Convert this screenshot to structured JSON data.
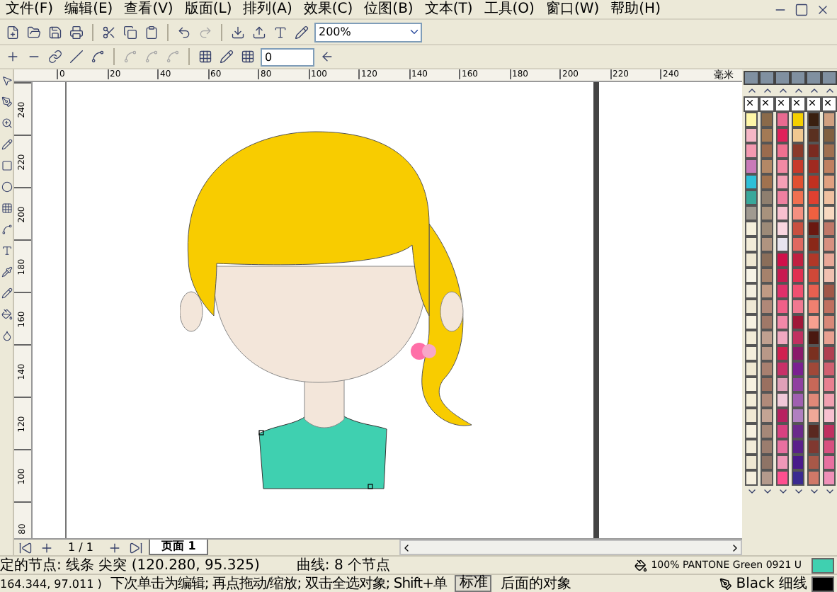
{
  "menu": [
    "文件(F)",
    "编辑(E)",
    "查看(V)",
    "版面(L)",
    "排列(A)",
    "效果(C)",
    "位图(B)",
    "文本(T)",
    "工具(O)",
    "窗口(W)",
    "帮助(H)"
  ],
  "toolbar": {
    "zoom": "200%"
  },
  "property_bar": {
    "value": "0"
  },
  "ruler": {
    "h_labels": [
      "0",
      "20",
      "40",
      "60",
      "80",
      "100",
      "120",
      "140",
      "160",
      "180",
      "200",
      "220",
      "240"
    ],
    "unit": "毫米",
    "v_labels": [
      "240",
      "220",
      "200",
      "180",
      "160",
      "140",
      "120",
      "100",
      "80"
    ]
  },
  "page_nav": {
    "count": "1 / 1",
    "tabs": [
      {
        "label": "页面 1",
        "selected": true
      }
    ]
  },
  "palettes": [
    {
      "swatches": [
        {
          "color": "#fff7a8"
        },
        {
          "color": "#f5b7c5"
        },
        {
          "color": "#f49ab0"
        },
        {
          "color": "#c97ab8"
        },
        {
          "color": "#2fc0d8"
        },
        {
          "color": "#3aa89a"
        },
        {
          "color": "#a09a90"
        },
        {
          "color": "#f5f0dc"
        },
        {
          "color": "#f2ecd8"
        },
        {
          "color": "#efe8d2"
        },
        {
          "color": "#f6f3e6"
        },
        {
          "color": "#f3eedf"
        },
        {
          "color": "#efe9d5"
        },
        {
          "color": "#f7f2e2"
        },
        {
          "color": "#f2ecd8"
        },
        {
          "color": "#f5efdc"
        },
        {
          "color": "#efe8d2"
        },
        {
          "color": "#f6f1e0"
        },
        {
          "color": "#f3edd8"
        },
        {
          "color": "#f0e9d4"
        },
        {
          "color": "#f6f0df"
        },
        {
          "color": "#f2ecd9"
        },
        {
          "color": "#efe8d3"
        },
        {
          "color": "#f5efdd"
        }
      ]
    },
    {
      "swatches": [
        {
          "color": "#8a6a4a"
        },
        {
          "color": "#a37a55"
        },
        {
          "color": "#9b6b4e"
        },
        {
          "color": "#b38866"
        },
        {
          "color": "#a0724f"
        },
        {
          "color": "#8f7f6f"
        },
        {
          "color": "#a8927d"
        },
        {
          "color": "#9c8a78"
        },
        {
          "color": "#b09480"
        },
        {
          "color": "#8a6e5a"
        },
        {
          "color": "#a6826c"
        },
        {
          "color": "#c09a84"
        },
        {
          "color": "#b08878"
        },
        {
          "color": "#a07868"
        },
        {
          "color": "#c0a090"
        },
        {
          "color": "#b89888"
        },
        {
          "color": "#a88070"
        },
        {
          "color": "#9a7060"
        },
        {
          "color": "#b08a7a"
        },
        {
          "color": "#c4a494"
        },
        {
          "color": "#a68878"
        },
        {
          "color": "#9b7d6e"
        },
        {
          "color": "#8e7466"
        },
        {
          "color": "#b49a8c"
        }
      ]
    },
    {
      "swatches": [
        {
          "color": "#e86a90"
        },
        {
          "color": "#e0205a"
        },
        {
          "color": "#f07090"
        },
        {
          "color": "#f38aa4"
        },
        {
          "color": "#f5a0b6"
        },
        {
          "color": "#ef80a0"
        },
        {
          "color": "#f7c0cf"
        },
        {
          "color": "#f9d6df"
        },
        {
          "color": "#e8e4ee"
        },
        {
          "color": "#d0104a"
        },
        {
          "color": "#c81a50"
        },
        {
          "color": "#e0306a"
        },
        {
          "color": "#f06088"
        },
        {
          "color": "#f288a8"
        },
        {
          "color": "#f0a8c0"
        },
        {
          "color": "#d02050"
        },
        {
          "color": "#c83068"
        },
        {
          "color": "#e0a0b8"
        },
        {
          "color": "#f0c8d8"
        },
        {
          "color": "#b82060"
        },
        {
          "color": "#d84080"
        },
        {
          "color": "#e870a0"
        },
        {
          "color": "#f098b8"
        },
        {
          "color": "#ff4f8f"
        }
      ]
    },
    {
      "swatches": [
        {
          "color": "#f5d000"
        },
        {
          "color": "#f0c890"
        },
        {
          "color": "#8a3a2a"
        },
        {
          "color": "#c83a2a"
        },
        {
          "color": "#e05030"
        },
        {
          "color": "#f07050"
        },
        {
          "color": "#f59080"
        },
        {
          "color": "#c85040"
        },
        {
          "color": "#e06860"
        },
        {
          "color": "#c02040"
        },
        {
          "color": "#e03050"
        },
        {
          "color": "#f05070"
        },
        {
          "color": "#f07890"
        },
        {
          "color": "#a01838"
        },
        {
          "color": "#c03060"
        },
        {
          "color": "#8a1a6a"
        },
        {
          "color": "#7a2090"
        },
        {
          "color": "#9040a0"
        },
        {
          "color": "#a060b0"
        },
        {
          "color": "#b080c0"
        },
        {
          "color": "#6a2a8a"
        },
        {
          "color": "#5a208a"
        },
        {
          "color": "#4a1a8a"
        },
        {
          "color": "#3a2a90"
        }
      ]
    },
    {
      "swatches": [
        {
          "color": "#3a2010"
        },
        {
          "color": "#5a3020"
        },
        {
          "color": "#7a2a20"
        },
        {
          "color": "#a02a20"
        },
        {
          "color": "#c03020"
        },
        {
          "color": "#e04030"
        },
        {
          "color": "#f06040"
        },
        {
          "color": "#6a1810"
        },
        {
          "color": "#8a2818"
        },
        {
          "color": "#b03828"
        },
        {
          "color": "#d04838"
        },
        {
          "color": "#e86050"
        },
        {
          "color": "#f08070"
        },
        {
          "color": "#f8a090"
        },
        {
          "color": "#4a1810"
        },
        {
          "color": "#7a3020"
        },
        {
          "color": "#a04838"
        },
        {
          "color": "#c86858"
        },
        {
          "color": "#e08878"
        },
        {
          "color": "#f0a898"
        },
        {
          "color": "#5a2820"
        },
        {
          "color": "#803830"
        },
        {
          "color": "#a85848"
        },
        {
          "color": "#d07868"
        }
      ]
    },
    {
      "swatches": [
        {
          "color": "#d0a080"
        },
        {
          "color": "#806040"
        },
        {
          "color": "#a07050"
        },
        {
          "color": "#c08060"
        },
        {
          "color": "#e0a080"
        },
        {
          "color": "#f0c0a0"
        },
        {
          "color": "#f8d8c0"
        },
        {
          "color": "#c07868"
        },
        {
          "color": "#d89080"
        },
        {
          "color": "#e8a898"
        },
        {
          "color": "#f0c0b0"
        },
        {
          "color": "#a05848"
        },
        {
          "color": "#c07060"
        },
        {
          "color": "#d88878"
        },
        {
          "color": "#e8a090"
        },
        {
          "color": "#b04050"
        },
        {
          "color": "#d06070"
        },
        {
          "color": "#e88090"
        },
        {
          "color": "#f0a0b0"
        },
        {
          "color": "#f8c0d0"
        },
        {
          "color": "#c03060"
        },
        {
          "color": "#d85080"
        },
        {
          "color": "#e870a0"
        },
        {
          "color": "#f090b8"
        }
      ]
    }
  ],
  "status": {
    "selection": "定的节点: 线条 尖突 (120.280, 95.325)",
    "object_info": "曲线: 8 个节点",
    "fill": {
      "label": "100% PANTONE Green 0921 U",
      "color": "#3fd0b0"
    },
    "coordinates": "164.344, 97.011 )",
    "hint": "下次单击为编辑; 再点拖动/缩放; 双击全选对象; Shift+单",
    "mode": "标准",
    "hint_end": "后面的对象",
    "outline": {
      "label": "Black 细线",
      "color": "#000000"
    }
  }
}
